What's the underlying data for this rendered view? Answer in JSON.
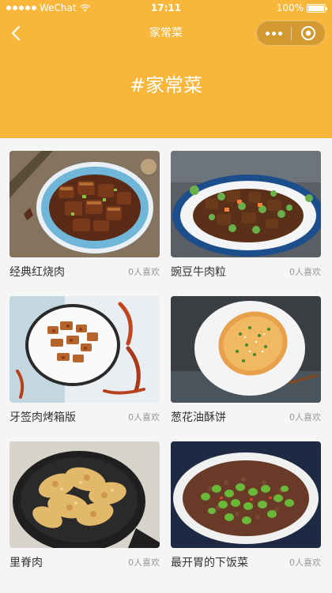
{
  "status_bar": {
    "carrier": "WeChat",
    "time": "17:11",
    "battery": "100%",
    "battery_level": 1.0,
    "signal_bars": 5
  },
  "navbar": {
    "title": "家常菜"
  },
  "hero": {
    "title": "#家常菜"
  },
  "dishes": [
    {
      "name": "经典红烧肉",
      "likes": "0人喜欢"
    },
    {
      "name": "豌豆牛肉粒",
      "likes": "0人喜欢"
    },
    {
      "name": "牙签肉烤箱版",
      "likes": "0人喜欢"
    },
    {
      "name": "葱花油酥饼",
      "likes": "0人喜欢"
    },
    {
      "name": "里脊肉",
      "likes": "0人喜欢"
    },
    {
      "name": "最开胃的下饭菜",
      "likes": "0人喜欢"
    }
  ],
  "icons": {
    "back": "chevron-left-icon",
    "more": "more-dots-icon",
    "close": "close-circle-icon",
    "wifi": "wifi-icon"
  },
  "colors": {
    "primary": "#F8B63A",
    "text": "#333333",
    "muted": "#999999",
    "background": "#f5f5f5"
  }
}
